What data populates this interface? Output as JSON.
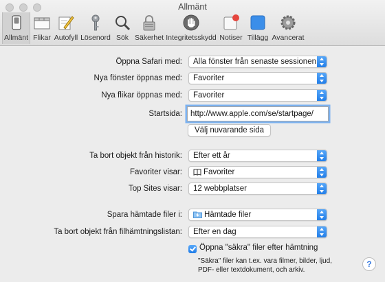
{
  "window": {
    "title": "Allmänt"
  },
  "toolbar": {
    "items": [
      {
        "label": "Allmänt",
        "selected": true
      },
      {
        "label": "Flikar"
      },
      {
        "label": "Autofyll"
      },
      {
        "label": "Lösenord"
      },
      {
        "label": "Sök"
      },
      {
        "label": "Säkerhet"
      },
      {
        "label": "Integritetsskydd"
      },
      {
        "label": "Notiser"
      },
      {
        "label": "Tillägg"
      },
      {
        "label": "Avancerat"
      }
    ]
  },
  "form": {
    "open_safari_with": {
      "label": "Öppna Safari med:",
      "value": "Alla fönster från senaste sessionen"
    },
    "new_windows_open_with": {
      "label": "Nya fönster öppnas med:",
      "value": "Favoriter"
    },
    "new_tabs_open_with": {
      "label": "Nya flikar öppnas med:",
      "value": "Favoriter"
    },
    "homepage": {
      "label": "Startsida:",
      "value": "http://www.apple.com/se/startpage/"
    },
    "set_current_page": {
      "label": "Välj nuvarande sida"
    },
    "remove_history_items": {
      "label": "Ta bort objekt från historik:",
      "value": "Efter ett år"
    },
    "favorites_shows": {
      "label": "Favoriter visar:",
      "value": "Favoriter"
    },
    "top_sites_shows": {
      "label": "Top Sites visar:",
      "value": "12 webbplatser"
    },
    "save_downloaded_files_to": {
      "label": "Spara hämtade filer i:",
      "value": "Hämtade filer"
    },
    "remove_download_list_items": {
      "label": "Ta bort objekt från filhämtningslistan:",
      "value": "Efter en dag"
    },
    "open_safe_files": {
      "label": "Öppna \"säkra\" filer efter hämtning",
      "checked": true,
      "note_line1": "\"Säkra\" filer kan t.ex. vara filmer, bilder, ljud,",
      "note_line2": "PDF- eller textdokument, och arkiv."
    }
  },
  "help": {
    "label": "?"
  },
  "colors": {
    "accent": "#2f86f0",
    "window": "#ececec"
  }
}
